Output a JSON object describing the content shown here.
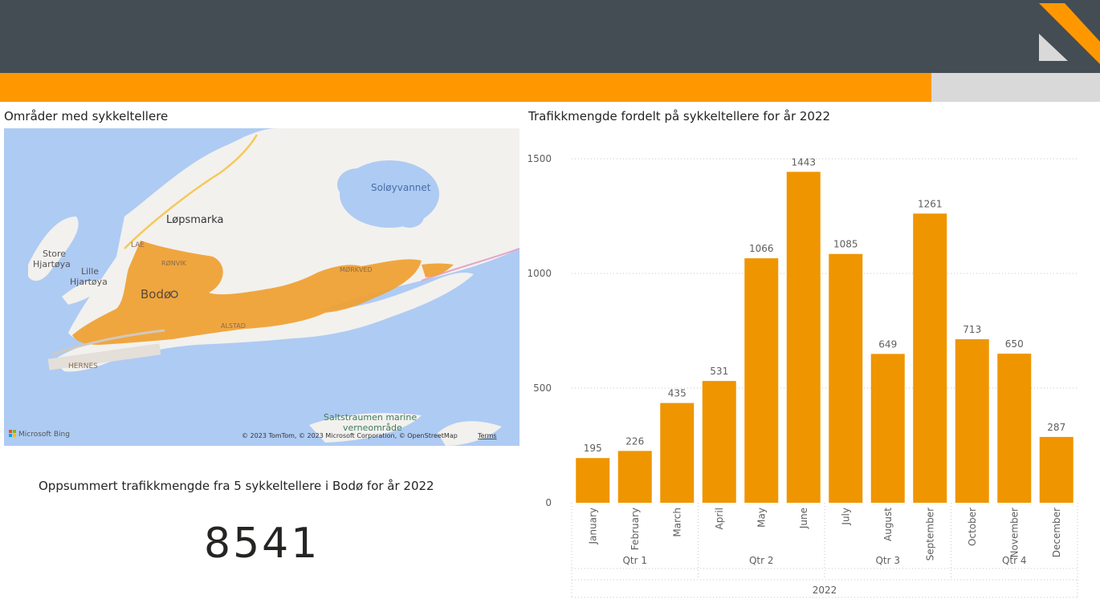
{
  "map_panel": {
    "title": "Områder med sykkeltellere",
    "labels": {
      "solovannet": "Soløyvannet",
      "lopsmarka": "Løpsmarka",
      "store": "Store",
      "hjartoya": "Hjartøya",
      "lille": "Lille",
      "hjartoya2": "Hjartøya",
      "lae": "LAE",
      "ronvik": "RØNVIK",
      "bodo": "Bodø",
      "mor": "MØRKVED",
      "alstad": "ALSTAD",
      "hernes": "HERNES",
      "saltstraumen1": "Saltstraumen marine",
      "saltstraumen2": "verneområde"
    },
    "attribution": "© 2023 TomTom, © 2023 Microsoft Corporation, © OpenStreetMap",
    "terms": "Terms",
    "bing": "Microsoft Bing",
    "colors": {
      "water": "#aecbf3",
      "land": "#f2f1ee",
      "highlight": "#f0a030"
    }
  },
  "summary": {
    "title": "Oppsummert trafikkmengde fra 5 sykkeltellere i Bodø for år 2022",
    "value": "8541"
  },
  "chart_panel": {
    "title": "Trafikkmengde fordelt på sykkeltellere for år 2022"
  },
  "chart_data": {
    "type": "bar",
    "categories": [
      "January",
      "February",
      "March",
      "April",
      "May",
      "June",
      "July",
      "August",
      "September",
      "October",
      "November",
      "December"
    ],
    "values": [
      195,
      226,
      435,
      531,
      1066,
      1443,
      1085,
      649,
      1261,
      713,
      650,
      287
    ],
    "quarters": [
      {
        "label": "Qtr 1",
        "months": 3
      },
      {
        "label": "Qtr 2",
        "months": 3
      },
      {
        "label": "Qtr 3",
        "months": 3
      },
      {
        "label": "Qtr 4",
        "months": 3
      }
    ],
    "year_label": "2022",
    "yticks": [
      0,
      500,
      1000,
      1500
    ],
    "ylim": [
      0,
      1500
    ],
    "bar_color": "#ef9500",
    "grid": true
  },
  "colors": {
    "header": "#444d54",
    "accent": "#ff9800",
    "grey_strip": "#d9d9d9"
  }
}
